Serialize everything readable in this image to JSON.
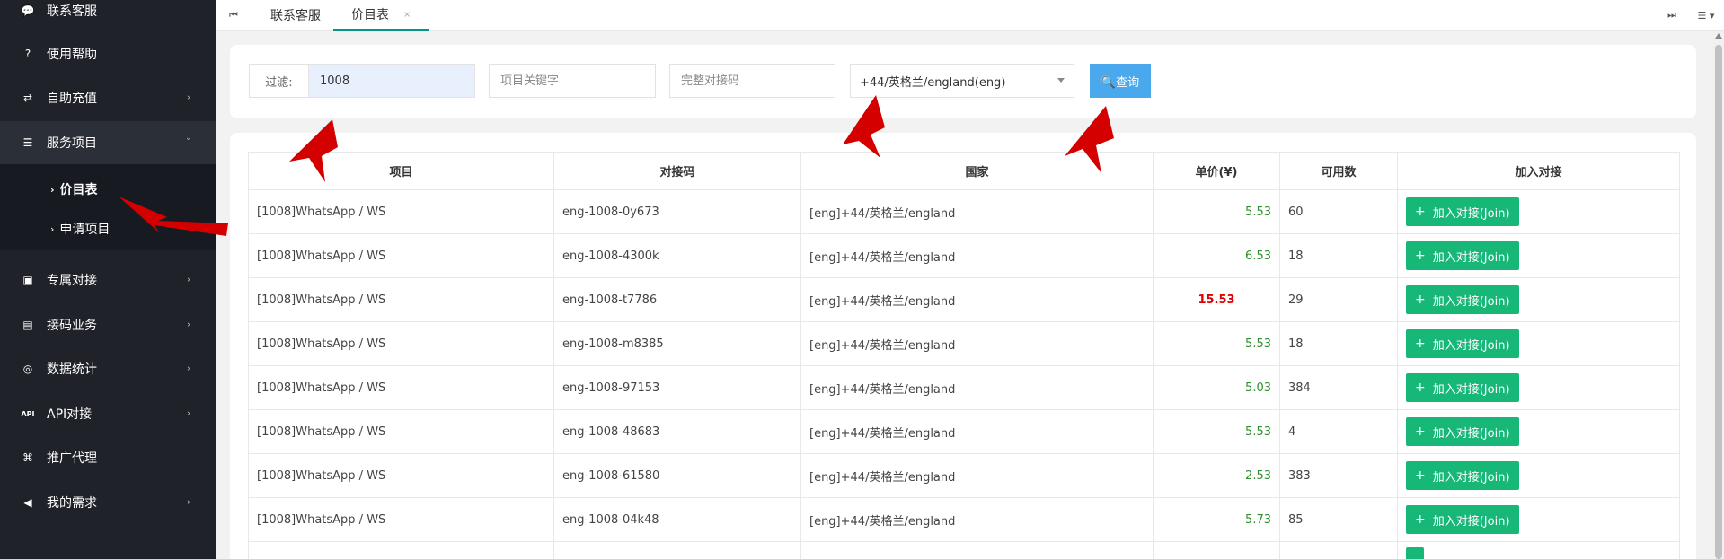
{
  "sidebar": {
    "items": [
      {
        "label": "联系客服",
        "icon": "chat-bubble-icon",
        "glyph": "💬",
        "chev": ""
      },
      {
        "label": "使用帮助",
        "icon": "question-icon",
        "glyph": "?",
        "chev": ""
      },
      {
        "label": "自助充值",
        "icon": "recharge-icon",
        "glyph": "⇄",
        "chev": "›"
      },
      {
        "label": "服务项目",
        "icon": "service-list-icon",
        "glyph": "☰",
        "chev": "˅"
      },
      {
        "label": "专属对接",
        "icon": "exclusive-icon",
        "glyph": "▣",
        "chev": "›"
      },
      {
        "label": "接码业务",
        "icon": "sms-code-icon",
        "glyph": "▤",
        "chev": "›"
      },
      {
        "label": "数据统计",
        "icon": "database-icon",
        "glyph": "◎",
        "chev": "›"
      },
      {
        "label": "API对接",
        "icon": "api-icon",
        "glyph": "API",
        "chev": "›"
      },
      {
        "label": "推广代理",
        "icon": "sitemap-icon",
        "glyph": "⌘",
        "chev": ""
      },
      {
        "label": "我的需求",
        "icon": "megaphone-icon",
        "glyph": "◀",
        "chev": "›"
      }
    ],
    "subitems": [
      {
        "label": "价目表"
      },
      {
        "label": "申请项目"
      }
    ]
  },
  "tabs": [
    {
      "label": "联系客服"
    },
    {
      "label": "价目表",
      "close": "×"
    }
  ],
  "tabbar": {
    "first_glyph": "⏮",
    "last_glyph": "⏭",
    "menu_glyph": "☰ ▾"
  },
  "filter": {
    "label": "过滤:",
    "value": "1008",
    "keyword_placeholder": "项目关键字",
    "code_placeholder": "完整对接码",
    "country_selected": "+44/英格兰/england(eng)",
    "query_label": "🔍查询"
  },
  "table": {
    "headers": [
      "项目",
      "对接码",
      "国家",
      "单价(¥)",
      "可用数",
      "加入对接"
    ],
    "join_label": "加入对接(Join)",
    "rows": [
      {
        "project": "[1008]WhatsApp / WS",
        "code": "eng-1008-0y673",
        "country": "[eng]+44/英格兰/england",
        "price": "5.53",
        "available": "60"
      },
      {
        "project": "[1008]WhatsApp / WS",
        "code": "eng-1008-4300k",
        "country": "[eng]+44/英格兰/england",
        "price": "6.53",
        "available": "18"
      },
      {
        "project": "[1008]WhatsApp / WS",
        "code": "eng-1008-t7786",
        "country": "[eng]+44/英格兰/england",
        "price": "15.53",
        "available": "29"
      },
      {
        "project": "[1008]WhatsApp / WS",
        "code": "eng-1008-m8385",
        "country": "[eng]+44/英格兰/england",
        "price": "5.53",
        "available": "18"
      },
      {
        "project": "[1008]WhatsApp / WS",
        "code": "eng-1008-97153",
        "country": "[eng]+44/英格兰/england",
        "price": "5.03",
        "available": "384"
      },
      {
        "project": "[1008]WhatsApp / WS",
        "code": "eng-1008-48683",
        "country": "[eng]+44/英格兰/england",
        "price": "5.53",
        "available": "4"
      },
      {
        "project": "[1008]WhatsApp / WS",
        "code": "eng-1008-61580",
        "country": "[eng]+44/英格兰/england",
        "price": "2.53",
        "available": "383"
      },
      {
        "project": "[1008]WhatsApp / WS",
        "code": "eng-1008-04k48",
        "country": "[eng]+44/英格兰/england",
        "price": "5.73",
        "available": "85"
      }
    ]
  },
  "colors": {
    "sidebar_bg": "#20222a",
    "join_green": "#16b777",
    "query_blue": "#4aa8ec",
    "price_green": "#2f8f2f",
    "price_red": "#e00000",
    "annotation_red": "#d40000"
  }
}
